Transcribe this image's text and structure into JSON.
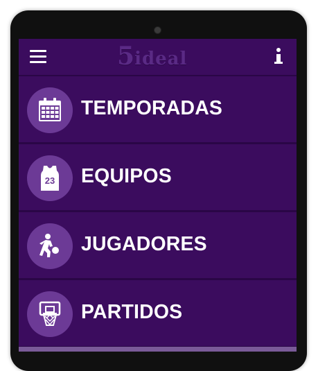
{
  "app": {
    "logo_number": "5",
    "logo_word": "ideal"
  },
  "topbar": {
    "menu_icon": "hamburger-icon",
    "info_icon": "info-icon"
  },
  "menu": {
    "items": [
      {
        "label": "TEMPORADAS",
        "icon": "calendar-icon"
      },
      {
        "label": "EQUIPOS",
        "icon": "jersey-icon",
        "jersey_number": "23"
      },
      {
        "label": "JUGADORES",
        "icon": "player-dribbling-icon"
      },
      {
        "label": "PARTIDOS",
        "icon": "basketball-hoop-icon"
      }
    ]
  },
  "colors": {
    "background": "#3b0c5e",
    "divider": "#2a0646",
    "icon_circle": "#6c3a96",
    "text": "#ffffff"
  }
}
